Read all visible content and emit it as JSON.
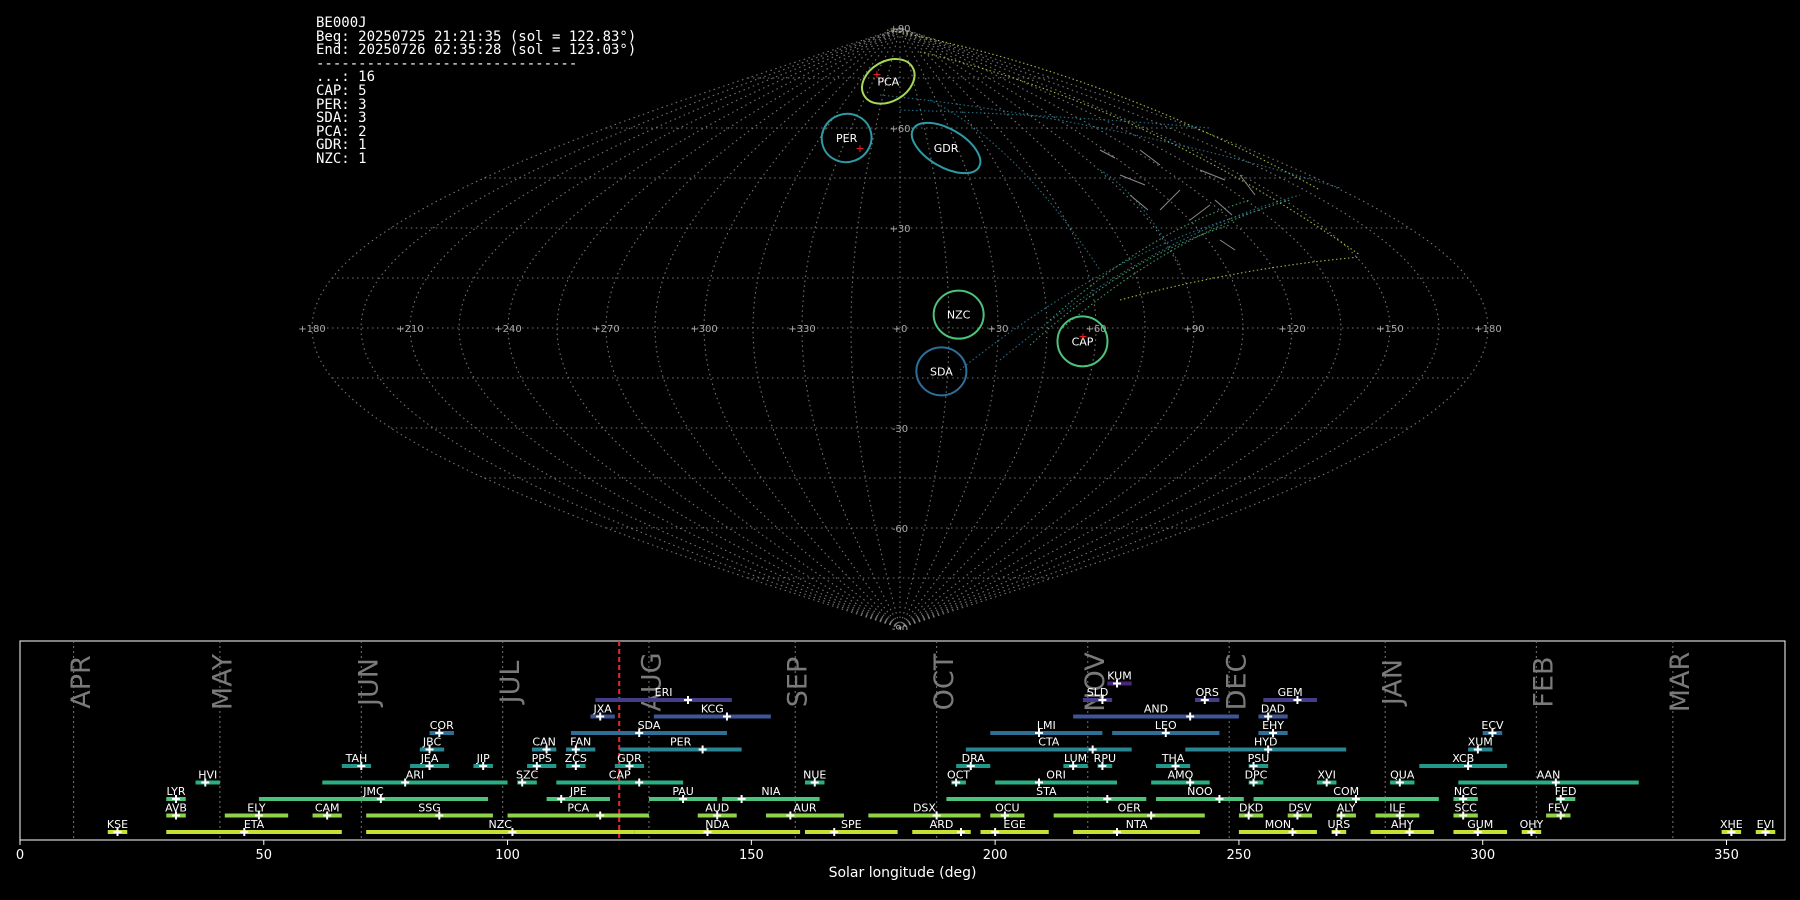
{
  "info": {
    "station": "BE000J",
    "beg": "Beg: 20250725 21:21:35 (sol = 122.83°)",
    "end": "End: 20250726 02:35:28 (sol = 123.03°)",
    "separator": "-------------------------------",
    "counts": [
      {
        "code": "...",
        "n": 16
      },
      {
        "code": "CAP",
        "n": 5
      },
      {
        "code": "PER",
        "n": 3
      },
      {
        "code": "SDA",
        "n": 3
      },
      {
        "code": "PCA",
        "n": 2
      },
      {
        "code": "GDR",
        "n": 1
      },
      {
        "code": "NZC",
        "n": 1
      }
    ]
  },
  "chart_data": [
    {
      "type": "scatter",
      "projection": "sinusoidal sky map",
      "lon_labels": [
        "+180",
        "+150",
        "+120",
        "+90",
        "+60",
        "+30",
        "+0",
        "+330",
        "+300",
        "+270",
        "+240",
        "+210",
        "+180"
      ],
      "lat_labels": [
        "+90",
        "+60",
        "+30",
        "-30",
        "-60",
        "-90"
      ],
      "radiants": [
        {
          "code": "PCA",
          "lon": 13,
          "lat": 74,
          "color": "#a6d854"
        },
        {
          "code": "PER",
          "lon": 30,
          "lat": 57,
          "color": "#2e9aa6"
        },
        {
          "code": "GDR",
          "lon": 336,
          "lat": 54,
          "color": "#2e9aa6"
        },
        {
          "code": "NZC",
          "lon": 342,
          "lat": 4,
          "color": "#4cc37a"
        },
        {
          "code": "CAP",
          "lon": 304,
          "lat": -4,
          "color": "#4cc37a"
        },
        {
          "code": "SDA",
          "lon": 347,
          "lat": -13,
          "color": "#2c6f9a"
        }
      ]
    },
    {
      "type": "timeline",
      "xlabel": "Solar longitude (deg)",
      "xlim": [
        0,
        362
      ],
      "xticks": [
        0,
        50,
        100,
        150,
        200,
        250,
        300,
        350
      ],
      "current_sol": 122.9,
      "months": [
        {
          "name": "APR",
          "sol": 12
        },
        {
          "name": "MAY",
          "sol": 41
        },
        {
          "name": "JUN",
          "sol": 71
        },
        {
          "name": "JUL",
          "sol": 100
        },
        {
          "name": "AUG",
          "sol": 129
        },
        {
          "name": "SEP",
          "sol": 159
        },
        {
          "name": "OCT",
          "sol": 189
        },
        {
          "name": "NOV",
          "sol": 220
        },
        {
          "name": "DEC",
          "sol": 249
        },
        {
          "name": "JAN",
          "sol": 281
        },
        {
          "name": "FEB",
          "sol": 312
        },
        {
          "name": "MAR",
          "sol": 340
        }
      ],
      "showers": [
        {
          "code": "KUM",
          "start": 223,
          "end": 228,
          "peak": 225,
          "row": 9
        },
        {
          "code": "ERI",
          "start": 118,
          "end": 146,
          "peak": 137,
          "row": 8
        },
        {
          "code": "SLD",
          "start": 218,
          "end": 224,
          "peak": 222,
          "row": 8
        },
        {
          "code": "ORS",
          "start": 241,
          "end": 246,
          "peak": 243,
          "row": 8
        },
        {
          "code": "GEM",
          "start": 255,
          "end": 266,
          "peak": 262,
          "row": 8
        },
        {
          "code": "JXA",
          "start": 117,
          "end": 122,
          "peak": 119,
          "row": 7
        },
        {
          "code": "KCG",
          "start": 130,
          "end": 154,
          "peak": 145,
          "row": 7
        },
        {
          "code": "AND",
          "start": 216,
          "end": 250,
          "peak": 240,
          "row": 7
        },
        {
          "code": "DAD",
          "start": 254,
          "end": 260,
          "peak": 256,
          "row": 7
        },
        {
          "code": "COR",
          "start": 84,
          "end": 89,
          "peak": 86,
          "row": 6
        },
        {
          "code": "SDA",
          "start": 113,
          "end": 145,
          "peak": 127,
          "row": 6
        },
        {
          "code": "LMI",
          "start": 199,
          "end": 222,
          "peak": 209,
          "row": 6
        },
        {
          "code": "LEO",
          "start": 224,
          "end": 246,
          "peak": 235,
          "row": 6
        },
        {
          "code": "EHY",
          "start": 254,
          "end": 260,
          "peak": 257,
          "row": 6
        },
        {
          "code": "ECV",
          "start": 300,
          "end": 304,
          "peak": 302,
          "row": 6
        },
        {
          "code": "JBC",
          "start": 82,
          "end": 87,
          "peak": 84,
          "row": 5
        },
        {
          "code": "CAN",
          "start": 105,
          "end": 110,
          "peak": 108,
          "row": 5
        },
        {
          "code": "FAN",
          "start": 112,
          "end": 118,
          "peak": 114,
          "row": 5
        },
        {
          "code": "PER",
          "start": 123,
          "end": 148,
          "peak": 140,
          "row": 5
        },
        {
          "code": "CTA",
          "start": 194,
          "end": 228,
          "peak": 220,
          "row": 5
        },
        {
          "code": "HYD",
          "start": 239,
          "end": 272,
          "peak": 256,
          "row": 5
        },
        {
          "code": "XUM",
          "start": 297,
          "end": 302,
          "peak": 299,
          "row": 5
        },
        {
          "code": "TAH",
          "start": 66,
          "end": 72,
          "peak": 70,
          "row": 4
        },
        {
          "code": "JEA",
          "start": 80,
          "end": 88,
          "peak": 84,
          "row": 4
        },
        {
          "code": "JIP",
          "start": 93,
          "end": 97,
          "peak": 95,
          "row": 4
        },
        {
          "code": "PPS",
          "start": 104,
          "end": 110,
          "peak": 106,
          "row": 4
        },
        {
          "code": "ZCS",
          "start": 112,
          "end": 116,
          "peak": 114,
          "row": 4
        },
        {
          "code": "GDR",
          "start": 122,
          "end": 128,
          "peak": 125,
          "row": 4
        },
        {
          "code": "DRA",
          "start": 192,
          "end": 199,
          "peak": 195,
          "row": 4
        },
        {
          "code": "LUM",
          "start": 214,
          "end": 219,
          "peak": 216,
          "row": 4
        },
        {
          "code": "RPU",
          "start": 221,
          "end": 224,
          "peak": 222,
          "row": 4
        },
        {
          "code": "THA",
          "start": 233,
          "end": 240,
          "peak": 237,
          "row": 4
        },
        {
          "code": "PSU",
          "start": 252,
          "end": 256,
          "peak": 253,
          "row": 4
        },
        {
          "code": "XCB",
          "start": 287,
          "end": 305,
          "peak": 297,
          "row": 4
        },
        {
          "code": "HVI",
          "start": 36,
          "end": 41,
          "peak": 38,
          "row": 3
        },
        {
          "code": "ARI",
          "start": 62,
          "end": 100,
          "peak": 79,
          "row": 3
        },
        {
          "code": "SZC",
          "start": 102,
          "end": 106,
          "peak": 103,
          "row": 3
        },
        {
          "code": "CAP",
          "start": 110,
          "end": 136,
          "peak": 127,
          "row": 3
        },
        {
          "code": "NUE",
          "start": 161,
          "end": 165,
          "peak": 163,
          "row": 3
        },
        {
          "code": "OCT",
          "start": 191,
          "end": 194,
          "peak": 192,
          "row": 3
        },
        {
          "code": "ORI",
          "start": 200,
          "end": 225,
          "peak": 209,
          "row": 3
        },
        {
          "code": "AMO",
          "start": 232,
          "end": 244,
          "peak": 240,
          "row": 3
        },
        {
          "code": "DPC",
          "start": 252,
          "end": 255,
          "peak": 253,
          "row": 3
        },
        {
          "code": "XVI",
          "start": 266,
          "end": 270,
          "peak": 268,
          "row": 3
        },
        {
          "code": "QUA",
          "start": 281,
          "end": 286,
          "peak": 283,
          "row": 3
        },
        {
          "code": "AAN",
          "start": 295,
          "end": 332,
          "peak": 315,
          "row": 3
        },
        {
          "code": "LYR",
          "start": 30,
          "end": 34,
          "peak": 32,
          "row": 2
        },
        {
          "code": "JMC",
          "start": 49,
          "end": 96,
          "peak": 74,
          "row": 2
        },
        {
          "code": "JPE",
          "start": 108,
          "end": 121,
          "peak": 111,
          "row": 2
        },
        {
          "code": "PAU",
          "start": 129,
          "end": 143,
          "peak": 136,
          "row": 2
        },
        {
          "code": "NIA",
          "start": 144,
          "end": 164,
          "peak": 148,
          "row": 2
        },
        {
          "code": "STA",
          "start": 190,
          "end": 231,
          "peak": 223,
          "row": 2
        },
        {
          "code": "NOO",
          "start": 233,
          "end": 251,
          "peak": 246,
          "row": 2
        },
        {
          "code": "COM",
          "start": 253,
          "end": 291,
          "peak": 274,
          "row": 2
        },
        {
          "code": "NCC",
          "start": 294,
          "end": 299,
          "peak": 296,
          "row": 2
        },
        {
          "code": "FED",
          "start": 315,
          "end": 319,
          "peak": 316,
          "row": 2
        },
        {
          "code": "AVB",
          "start": 30,
          "end": 34,
          "peak": 32,
          "row": 1
        },
        {
          "code": "ELY",
          "start": 42,
          "end": 55,
          "peak": 49,
          "row": 1
        },
        {
          "code": "CAM",
          "start": 60,
          "end": 66,
          "peak": 63,
          "row": 1
        },
        {
          "code": "SSG",
          "start": 71,
          "end": 97,
          "peak": 86,
          "row": 1
        },
        {
          "code": "PCA",
          "start": 100,
          "end": 129,
          "peak": 119,
          "row": 1
        },
        {
          "code": "AUD",
          "start": 139,
          "end": 147,
          "peak": 143,
          "row": 1
        },
        {
          "code": "AUR",
          "start": 153,
          "end": 169,
          "peak": 158,
          "row": 1
        },
        {
          "code": "DSX",
          "start": 174,
          "end": 197,
          "peak": 188,
          "row": 1
        },
        {
          "code": "OCU",
          "start": 199,
          "end": 206,
          "peak": 202,
          "row": 1
        },
        {
          "code": "OER",
          "start": 212,
          "end": 243,
          "peak": 232,
          "row": 1
        },
        {
          "code": "DKD",
          "start": 250,
          "end": 255,
          "peak": 252,
          "row": 1
        },
        {
          "code": "DSV",
          "start": 260,
          "end": 265,
          "peak": 262,
          "row": 1
        },
        {
          "code": "ALY",
          "start": 270,
          "end": 274,
          "peak": 271,
          "row": 1
        },
        {
          "code": "ILE",
          "start": 278,
          "end": 287,
          "peak": 283,
          "row": 1
        },
        {
          "code": "SCC",
          "start": 294,
          "end": 299,
          "peak": 296,
          "row": 1
        },
        {
          "code": "FEV",
          "start": 313,
          "end": 318,
          "peak": 316,
          "row": 1
        },
        {
          "code": "KSE",
          "start": 18,
          "end": 22,
          "peak": 20,
          "row": 0
        },
        {
          "code": "ETA",
          "start": 30,
          "end": 66,
          "peak": 46,
          "row": 0
        },
        {
          "code": "NZC",
          "start": 71,
          "end": 126,
          "peak": 101,
          "row": 0
        },
        {
          "code": "NDA",
          "start": 126,
          "end": 160,
          "peak": 141,
          "row": 0
        },
        {
          "code": "SPE",
          "start": 161,
          "end": 180,
          "peak": 167,
          "row": 0
        },
        {
          "code": "ARD",
          "start": 183,
          "end": 195,
          "peak": 193,
          "row": 0
        },
        {
          "code": "EGE",
          "start": 197,
          "end": 211,
          "peak": 200,
          "row": 0
        },
        {
          "code": "NTA",
          "start": 216,
          "end": 242,
          "peak": 225,
          "row": 0
        },
        {
          "code": "MON",
          "start": 250,
          "end": 266,
          "peak": 261,
          "row": 0
        },
        {
          "code": "URS",
          "start": 269,
          "end": 272,
          "peak": 270,
          "row": 0
        },
        {
          "code": "AHY",
          "start": 277,
          "end": 290,
          "peak": 285,
          "row": 0
        },
        {
          "code": "GUM",
          "start": 294,
          "end": 305,
          "peak": 299,
          "row": 0
        },
        {
          "code": "OHY",
          "start": 308,
          "end": 312,
          "peak": 310,
          "row": 0
        },
        {
          "code": "XHE",
          "start": 349,
          "end": 353,
          "peak": 351,
          "row": 0
        },
        {
          "code": "EVI",
          "start": 356,
          "end": 360,
          "peak": 358,
          "row": 0
        }
      ]
    }
  ]
}
